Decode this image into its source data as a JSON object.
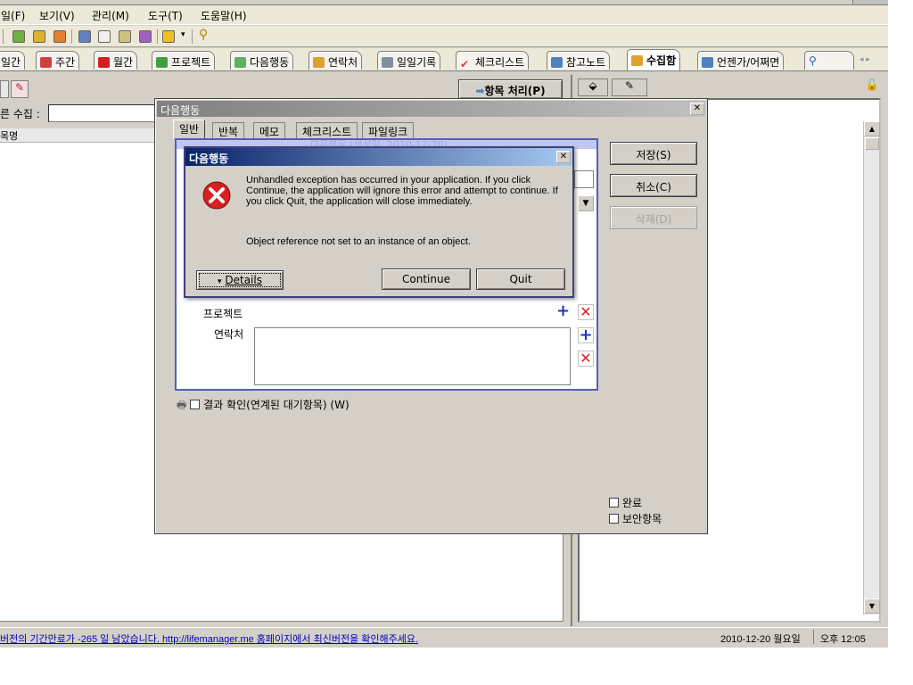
{
  "menu": [
    "일(F)",
    "보기(V)",
    "관리(M)",
    "도구(T)",
    "도움말(H)"
  ],
  "tabs": [
    {
      "label": "일간",
      "color": "#ffffff"
    },
    {
      "label": "주간",
      "color": "#d04040"
    },
    {
      "label": "월간",
      "color": "#d02020"
    },
    {
      "label": "프로젝트",
      "color": "#40a040"
    },
    {
      "label": "다음행동",
      "color": "#60b060"
    },
    {
      "label": "연락처",
      "color": "#e0a030"
    },
    {
      "label": "일일기록",
      "color": "#8090a0"
    },
    {
      "label": "체크리스트",
      "color": "#d04040"
    },
    {
      "label": "참고노트",
      "color": "#5080c0"
    },
    {
      "label": "수집함",
      "color": "#e0a030"
    },
    {
      "label": "언젠가/어쩌면",
      "color": "#5080c0"
    }
  ],
  "left": {
    "process_button": "항목 처리(P)",
    "collect_label": "른 수집 :",
    "list_header": "목명"
  },
  "dialog": {
    "title": "다음행동",
    "tabs": [
      "일반",
      "반복",
      "메모",
      "체크리스트",
      "파일링크"
    ],
    "faded_text": "다음행동 (생성일: 2010-12-20)",
    "project_label": "프로젝트",
    "contact_label": "연락처",
    "result_check_label": "결과 확인(연계된 대기항목) (W)",
    "save_button": "저장(S)",
    "cancel_button": "취소(C)",
    "delete_button": "삭제(D)",
    "complete_label": "완료",
    "secure_label": "보안항목"
  },
  "error": {
    "title": "다음행동",
    "message": "Unhandled exception has occurred in your application. If you click Continue, the application will ignore this error and attempt to continue. If you click Quit, the application will close immediately.",
    "detail": "Object reference not set to an instance of an object.",
    "details_button": "Details",
    "continue_button": "Continue",
    "quit_button": "Quit"
  },
  "status": {
    "message": "버전의 기간만료가 -265 일 남았습니다. http://lifemanager.me 홈페이지에서 최신버전을 확인해주세요.",
    "date": "2010-12-20 월요일",
    "time": "오후 12:05"
  },
  "colors": {
    "error_title": "#0a246a",
    "dialog_border": "#5060c0",
    "status_link": "#0000c0"
  }
}
